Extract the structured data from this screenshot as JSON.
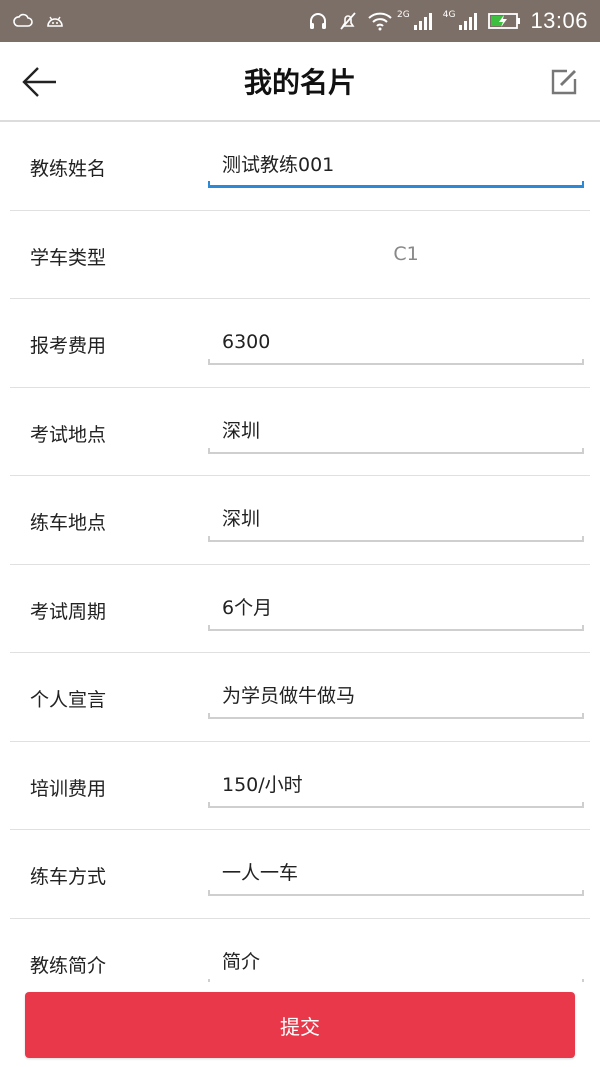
{
  "status_bar": {
    "net_2g": "2G",
    "net_4g": "4G",
    "time": "13:06",
    "colors": {
      "background": "#7c6f67",
      "battery_fill": "#3fbf3f"
    }
  },
  "header": {
    "title": "我的名片",
    "back_icon": "arrow-left-icon",
    "edit_icon": "edit-icon"
  },
  "form": {
    "rows": [
      {
        "label": "教练姓名",
        "value": "测试教练001",
        "focused": true
      },
      {
        "label": "学车类型",
        "value": "C1",
        "editable": false
      },
      {
        "label": "报考费用",
        "value": "6300"
      },
      {
        "label": "考试地点",
        "value": "深圳"
      },
      {
        "label": "练车地点",
        "value": "深圳"
      },
      {
        "label": "考试周期",
        "value": "6个月"
      },
      {
        "label": "个人宣言",
        "value": "为学员做牛做马"
      },
      {
        "label": "培训费用",
        "value": "150/小时"
      },
      {
        "label": "练车方式",
        "value": "一人一车"
      },
      {
        "label": "教练简介",
        "value": "简介"
      }
    ]
  },
  "submit": {
    "label": "提交",
    "color": "#e9384a"
  },
  "colors": {
    "focus_underline": "#2b8ad8",
    "divider": "#e0e0e0"
  }
}
